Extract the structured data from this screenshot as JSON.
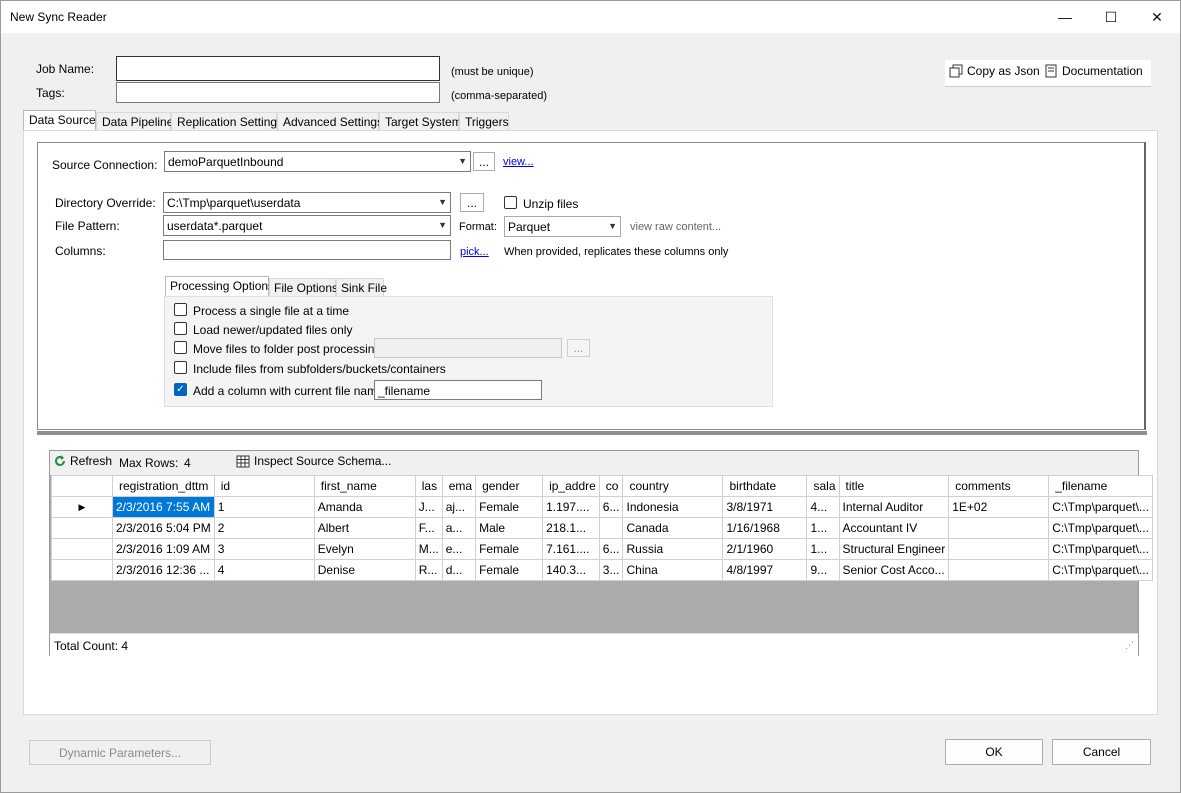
{
  "window": {
    "title": "New Sync Reader",
    "controls": {
      "minimize": "—",
      "maximize": "☐",
      "close": "✕"
    }
  },
  "header": {
    "job_name_label": "Job Name:",
    "job_name_value": "",
    "job_name_hint": "(must be unique)",
    "tags_label": "Tags:",
    "tags_value": "",
    "tags_hint": "(comma-separated)",
    "copy_json_label": "Copy as Json",
    "documentation_label": "Documentation"
  },
  "tabs": [
    {
      "label": "Data Source"
    },
    {
      "label": "Data Pipeline"
    },
    {
      "label": "Replication Settings"
    },
    {
      "label": "Advanced Settings"
    },
    {
      "label": "Target System"
    },
    {
      "label": "Triggers"
    }
  ],
  "source": {
    "connection_label": "Source Connection:",
    "connection_value": "demoParquetInbound",
    "browse_label": "...",
    "view_link": "view...",
    "directory_label": "Directory Override:",
    "directory_value": "C:\\Tmp\\parquet\\userdata",
    "directory_browse": "...",
    "unzip_label": "Unzip files",
    "file_pattern_label": "File Pattern:",
    "file_pattern_value": "userdata*.parquet",
    "format_label": "Format:",
    "format_value": "Parquet",
    "view_raw_label": "view raw content...",
    "columns_label": "Columns:",
    "columns_value": "",
    "pick_link": "pick...",
    "columns_hint": "When provided, replicates these columns only"
  },
  "processing": {
    "tabs": [
      {
        "label": "Processing Options"
      },
      {
        "label": "File Options"
      },
      {
        "label": "Sink File"
      }
    ],
    "opt_single": "Process a single file at a time",
    "opt_newer": "Load newer/updated files only",
    "opt_move": "Move files to folder post processing:",
    "move_browse": "...",
    "opt_subfolders": "Include files from subfolders/buckets/containers",
    "opt_filename": "Add a column with current file name:",
    "filename_value": "_filename"
  },
  "preview": {
    "refresh_label": "Refresh",
    "max_rows_label": "Max Rows:",
    "max_rows_value": "4",
    "inspect_label": "Inspect Source Schema...",
    "columns": [
      "registration_dttm",
      "id",
      "first_name",
      "las",
      "ema",
      "gender",
      "ip_addre",
      "co",
      "country",
      "birthdate",
      "sala",
      "title",
      "comments",
      "_filename"
    ],
    "rows": [
      [
        "2/3/2016 7:55 AM",
        "1",
        "Amanda",
        "J...",
        "aj...",
        "Female",
        "1.197....",
        "6...",
        "Indonesia",
        "3/8/1971",
        "4...",
        "Internal Auditor",
        "1E+02",
        "C:\\Tmp\\parquet\\..."
      ],
      [
        "2/3/2016 5:04 PM",
        "2",
        "Albert",
        "F...",
        "a...",
        "Male",
        "218.1...",
        "",
        "Canada",
        "1/16/1968",
        "1...",
        "Accountant IV",
        "",
        "C:\\Tmp\\parquet\\..."
      ],
      [
        "2/3/2016 1:09 AM",
        "3",
        "Evelyn",
        "M...",
        "e...",
        "Female",
        "7.161....",
        "6...",
        "Russia",
        "2/1/1960",
        "1...",
        "Structural Engineer",
        "",
        "C:\\Tmp\\parquet\\..."
      ],
      [
        "2/3/2016 12:36 ...",
        "4",
        "Denise",
        "R...",
        "d...",
        "Female",
        "140.3...",
        "3...",
        "China",
        "4/8/1997",
        "9...",
        "Senior Cost Acco...",
        "",
        "C:\\Tmp\\parquet\\..."
      ]
    ],
    "total_count": "Total Count: 4"
  },
  "footer": {
    "dynamic_params_label": "Dynamic Parameters...",
    "ok_label": "OK",
    "cancel_label": "Cancel"
  },
  "colors": {
    "accent": "#0078d7",
    "link": "#0000ee",
    "grid_empty": "#ababab"
  }
}
